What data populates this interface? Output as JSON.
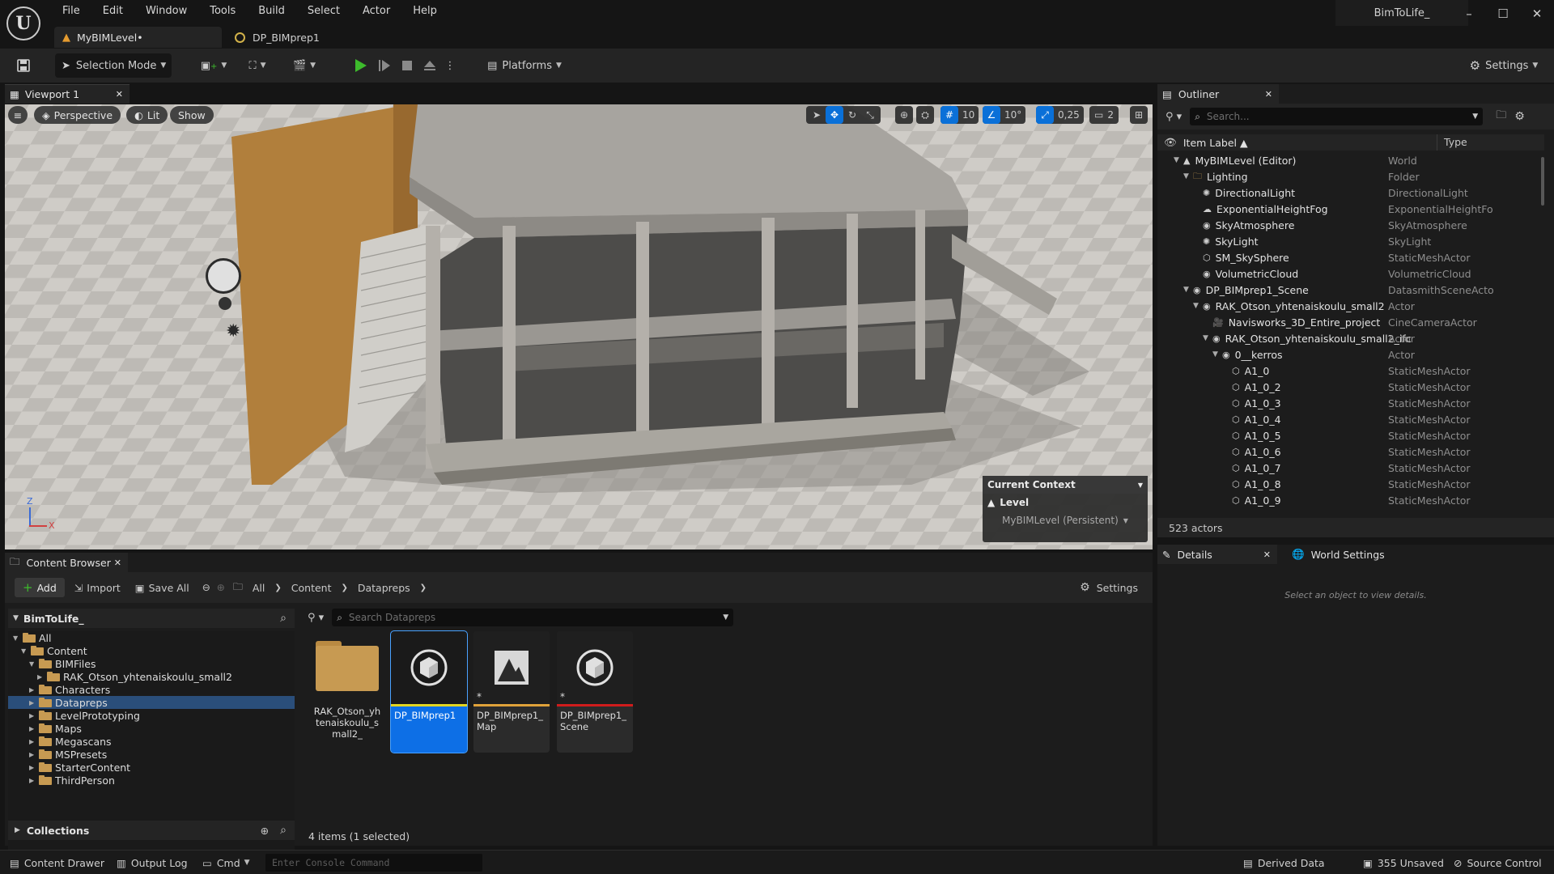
{
  "titlebar": {
    "menu": [
      "File",
      "Edit",
      "Window",
      "Tools",
      "Build",
      "Select",
      "Actor",
      "Help"
    ],
    "project": "BimToLife_",
    "window_controls": [
      "minimize-icon",
      "maximize-icon",
      "close-icon"
    ]
  },
  "doc_tabs": [
    {
      "label": "MyBIMLevel•",
      "icon": "level-icon"
    },
    {
      "label": "DP_BIMprep1",
      "icon": "dataprep-icon"
    }
  ],
  "toolbar": {
    "selection_mode": "Selection Mode",
    "platforms": "Platforms",
    "settings": "Settings",
    "play_color": "#3dbb2c"
  },
  "viewport": {
    "tab_label": "Viewport 1",
    "perspective": "Perspective",
    "lit": "Lit",
    "show": "Show",
    "grid_snap": "10",
    "rotation_snap": "10°",
    "scale_snap": "0,25",
    "camera_speed": "2",
    "axis_z": "Z",
    "axis_x": "X",
    "context": {
      "title": "Current Context",
      "level_label": "Level",
      "level_value": "MyBIMLevel (Persistent)"
    }
  },
  "outliner": {
    "tab_label": "Outliner",
    "search_placeholder": "Search...",
    "col_label": "Item Label ▲",
    "col_type": "Type",
    "rows": [
      {
        "label": "MyBIMLevel (Editor)",
        "type": "World",
        "depth": 0,
        "expanded": true
      },
      {
        "label": "Lighting",
        "type": "Folder",
        "depth": 1,
        "expanded": true
      },
      {
        "label": "DirectionalLight",
        "type": "DirectionalLight",
        "depth": 2
      },
      {
        "label": "ExponentialHeightFog",
        "type": "ExponentialHeightFog",
        "depth": 2
      },
      {
        "label": "SkyAtmosphere",
        "type": "SkyAtmosphere",
        "depth": 2
      },
      {
        "label": "SkyLight",
        "type": "SkyLight",
        "depth": 2
      },
      {
        "label": "SM_SkySphere",
        "type": "StaticMeshActor",
        "depth": 2
      },
      {
        "label": "VolumetricCloud",
        "type": "VolumetricCloud",
        "depth": 2
      },
      {
        "label": "DP_BIMprep1_Scene",
        "type": "DatasmithSceneActor",
        "depth": 1,
        "expanded": true
      },
      {
        "label": "RAK_Otson_yhtenaiskoulu_small2",
        "type": "Actor",
        "depth": 2,
        "expanded": true
      },
      {
        "label": "Navisworks_3D_Entire_project",
        "type": "CineCameraActor",
        "depth": 3
      },
      {
        "label": "RAK_Otson_yhtenaiskoulu_small2_ifc",
        "type": "Actor",
        "depth": 3,
        "expanded": true
      },
      {
        "label": "0__kerros",
        "type": "Actor",
        "depth": 4,
        "expanded": true
      },
      {
        "label": "A1_0",
        "type": "StaticMeshActor",
        "depth": 5
      },
      {
        "label": "A1_0_2",
        "type": "StaticMeshActor",
        "depth": 5
      },
      {
        "label": "A1_0_3",
        "type": "StaticMeshActor",
        "depth": 5
      },
      {
        "label": "A1_0_4",
        "type": "StaticMeshActor",
        "depth": 5
      },
      {
        "label": "A1_0_5",
        "type": "StaticMeshActor",
        "depth": 5
      },
      {
        "label": "A1_0_6",
        "type": "StaticMeshActor",
        "depth": 5
      },
      {
        "label": "A1_0_7",
        "type": "StaticMeshActor",
        "depth": 5
      },
      {
        "label": "A1_0_8",
        "type": "StaticMeshActor",
        "depth": 5
      },
      {
        "label": "A1_0_9",
        "type": "StaticMeshActor",
        "depth": 5
      }
    ],
    "actor_count": "523 actors"
  },
  "details": {
    "tab_details": "Details",
    "tab_world": "World Settings",
    "empty_hint": "Select an object to view details."
  },
  "content_browser": {
    "tab_label": "Content Browser",
    "add": "Add",
    "import": "Import",
    "save_all": "Save All",
    "breadcrumb": [
      "All",
      "Content",
      "Datapreps"
    ],
    "settings": "Settings",
    "root": "BimToLife_",
    "search_placeholder": "Search Datapreps",
    "tree": [
      {
        "label": "All",
        "depth": 0
      },
      {
        "label": "Content",
        "depth": 1
      },
      {
        "label": "BIMFiles",
        "depth": 2
      },
      {
        "label": "RAK_Otson_yhtenaiskoulu_small2",
        "depth": 3
      },
      {
        "label": "Characters",
        "depth": 2
      },
      {
        "label": "Datapreps",
        "depth": 2,
        "selected": true
      },
      {
        "label": "LevelPrototyping",
        "depth": 2
      },
      {
        "label": "Maps",
        "depth": 2
      },
      {
        "label": "Megascans",
        "depth": 2
      },
      {
        "label": "MSPresets",
        "depth": 2
      },
      {
        "label": "StarterContent",
        "depth": 2
      },
      {
        "label": "ThirdPerson",
        "depth": 2
      }
    ],
    "collections": "Collections",
    "assets": [
      {
        "label": "RAK_Otson_yhtenaiskoulu_small2_",
        "kind": "folder"
      },
      {
        "label": "DP_BIMprep1",
        "kind": "dataprep",
        "selected": true,
        "color": "#e3d51f"
      },
      {
        "label": "DP_BIMprep1_Map",
        "kind": "map",
        "color": "#e0a23a"
      },
      {
        "label": "DP_BIMprep1_Scene",
        "kind": "scene",
        "color": "#d01c1c"
      }
    ],
    "item_count": "4 items (1 selected)"
  },
  "statusbar": {
    "content_drawer": "Content Drawer",
    "output_log": "Output Log",
    "cmd": "Cmd",
    "console_placeholder": "Enter Console Command",
    "derived_data": "Derived Data",
    "unsaved": "355 Unsaved",
    "source_control": "Source Control"
  }
}
